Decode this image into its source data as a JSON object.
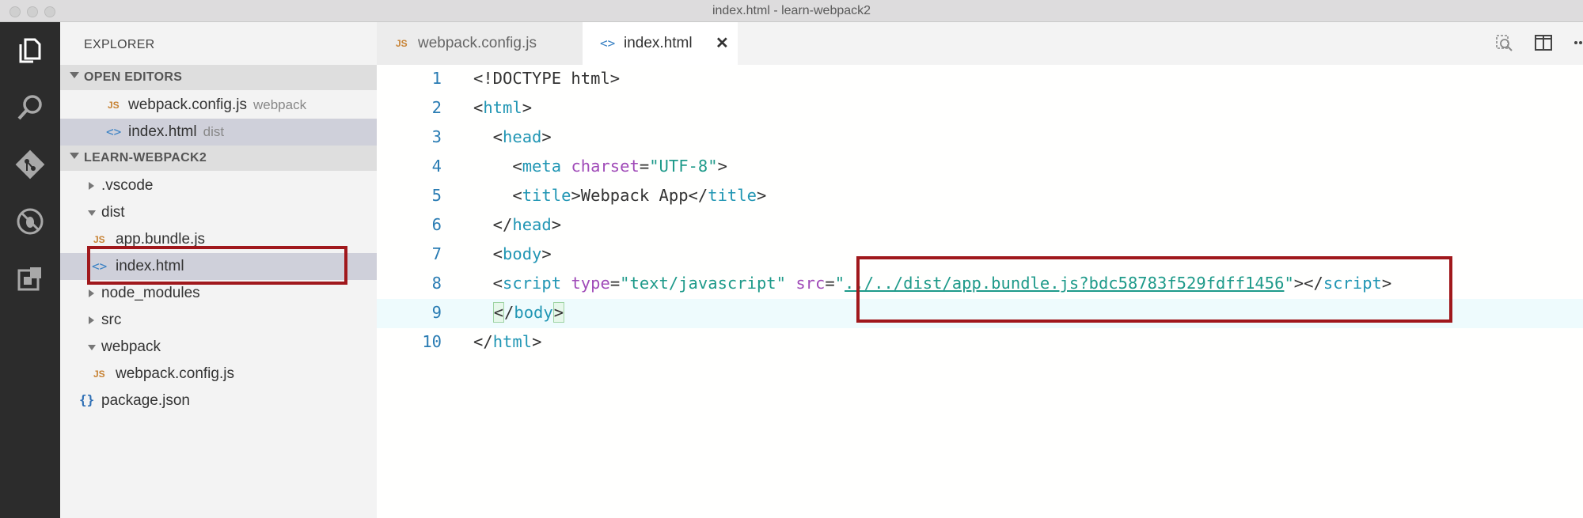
{
  "window": {
    "title": "index.html - learn-webpack2"
  },
  "activity_bar": {
    "items": [
      {
        "icon": "files-icon"
      },
      {
        "icon": "search-icon"
      },
      {
        "icon": "git-icon"
      },
      {
        "icon": "debug-icon"
      },
      {
        "icon": "extensions-icon"
      }
    ]
  },
  "sidebar": {
    "title": "EXPLORER",
    "open_editors": {
      "label": "OPEN EDITORS",
      "items": [
        {
          "icon": "JS",
          "name": "webpack.config.js",
          "folder": "webpack"
        },
        {
          "icon": "<>",
          "name": "index.html",
          "folder": "dist"
        }
      ]
    },
    "project": {
      "label": "LEARN-WEBPACK2",
      "items": [
        {
          "name": ".vscode"
        },
        {
          "name": "dist"
        },
        {
          "icon": "JS",
          "name": "app.bundle.js"
        },
        {
          "icon": "<>",
          "name": "index.html"
        },
        {
          "name": "node_modules"
        },
        {
          "name": "src"
        },
        {
          "name": "webpack"
        },
        {
          "icon": "JS",
          "name": "webpack.config.js"
        },
        {
          "icon": "{}",
          "name": "package.json"
        }
      ]
    }
  },
  "tabs": [
    {
      "icon": "JS",
      "label": "webpack.config.js",
      "active": false
    },
    {
      "icon": "<>",
      "label": "index.html",
      "active": true,
      "close": "✕"
    }
  ],
  "editor": {
    "lines": [
      {
        "n": "1",
        "parts": [
          [
            "p",
            "<!DOCTYPE html>"
          ]
        ]
      },
      {
        "n": "2",
        "parts": [
          [
            "p",
            "<"
          ],
          [
            "t",
            "html"
          ],
          [
            "p",
            ">"
          ]
        ]
      },
      {
        "n": "3",
        "parts": [
          [
            "p",
            "  <"
          ],
          [
            "t",
            "head"
          ],
          [
            "p",
            ">"
          ]
        ]
      },
      {
        "n": "4",
        "parts": [
          [
            "p",
            "    <"
          ],
          [
            "t",
            "meta"
          ],
          [
            "p",
            " "
          ],
          [
            "a",
            "charset"
          ],
          [
            "p",
            "="
          ],
          [
            "s",
            "\"UTF-8\""
          ],
          [
            "p",
            ">"
          ]
        ]
      },
      {
        "n": "5",
        "parts": [
          [
            "p",
            "    <"
          ],
          [
            "t",
            "title"
          ],
          [
            "p",
            ">Webpack App</"
          ],
          [
            "t",
            "title"
          ],
          [
            "p",
            ">"
          ]
        ]
      },
      {
        "n": "6",
        "parts": [
          [
            "p",
            "  </"
          ],
          [
            "t",
            "head"
          ],
          [
            "p",
            ">"
          ]
        ]
      },
      {
        "n": "7",
        "parts": [
          [
            "p",
            "  <"
          ],
          [
            "t",
            "body"
          ],
          [
            "p",
            ">"
          ]
        ]
      },
      {
        "n": "8",
        "parts": [
          [
            "p",
            "  <"
          ],
          [
            "t",
            "script"
          ],
          [
            "p",
            " "
          ],
          [
            "a",
            "type"
          ],
          [
            "p",
            "="
          ],
          [
            "s",
            "\"text/javascript\""
          ],
          [
            "p",
            " "
          ],
          [
            "a",
            "src"
          ],
          [
            "p",
            "="
          ],
          [
            "s",
            "\""
          ],
          [
            "u",
            "../../dist/app.bundle.js?bdc58783f529fdff1456"
          ],
          [
            "s",
            "\""
          ],
          [
            "p",
            "></"
          ],
          [
            "t",
            "script"
          ],
          [
            "p",
            ">"
          ]
        ]
      },
      {
        "n": "9",
        "parts": [
          [
            "p",
            "  "
          ],
          [
            "m",
            "<"
          ],
          [
            "p",
            "/"
          ],
          [
            "t",
            "body"
          ],
          [
            "m",
            ">"
          ]
        ]
      },
      {
        "n": "10",
        "parts": [
          [
            "p",
            "</"
          ],
          [
            "t",
            "html"
          ],
          [
            "p",
            ">"
          ]
        ]
      }
    ]
  },
  "colors": {
    "highlight_box": "#a0181c",
    "tag": "#2196b4",
    "attribute": "#a04bb8",
    "string": "#1e9a8a",
    "line_number": "#2a7cb3"
  }
}
